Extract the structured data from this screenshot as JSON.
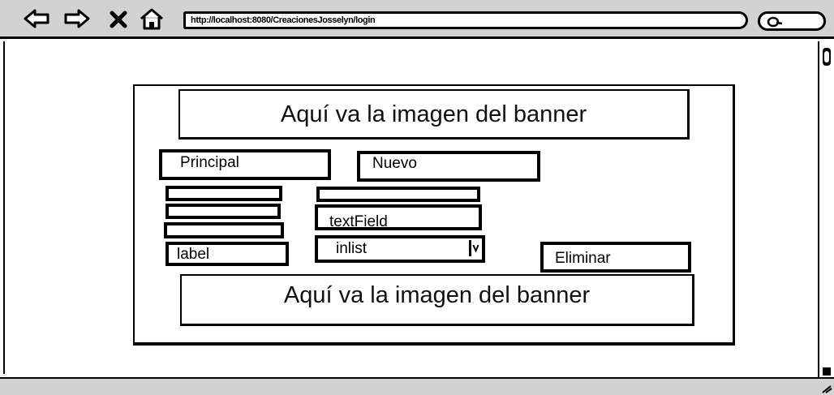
{
  "browser": {
    "url": "http://localhost:8080/CreacionesJosselyn/login",
    "icons": [
      "back-arrow-icon",
      "forward-arrow-icon",
      "close-x-icon",
      "home-icon",
      "search-icon"
    ]
  },
  "page": {
    "banner_top": "Aquí va la imagen del banner",
    "banner_bottom": "Aquí va la imagen del banner",
    "buttons": {
      "principal": "Principal",
      "nuevo": "Nuevo",
      "eliminar": "Eliminar"
    },
    "label_text": "label",
    "text_field_value": "textField",
    "list_value": "inlist"
  }
}
